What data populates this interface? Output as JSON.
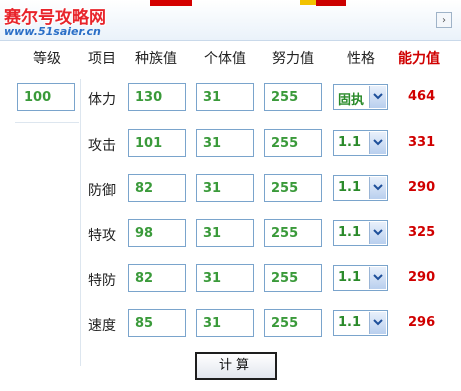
{
  "header": {
    "logo_title": "赛尔号攻略网",
    "logo_url": "www.51saier.cn",
    "nav_glyph": "›"
  },
  "columns": {
    "level": "等级",
    "item": "项目",
    "race": "种族值",
    "individual": "个体值",
    "effort": "努力值",
    "nature": "性格",
    "power": "能力值"
  },
  "level_value": "100",
  "stats": [
    {
      "label": "体力",
      "race": "130",
      "individual": "31",
      "effort": "255",
      "nature": "固执",
      "power": "464"
    },
    {
      "label": "攻击",
      "race": "101",
      "individual": "31",
      "effort": "255",
      "nature": "1.1",
      "power": "331"
    },
    {
      "label": "防御",
      "race": "82",
      "individual": "31",
      "effort": "255",
      "nature": "1.1",
      "power": "290"
    },
    {
      "label": "特攻",
      "race": "98",
      "individual": "31",
      "effort": "255",
      "nature": "1.1",
      "power": "325"
    },
    {
      "label": "特防",
      "race": "82",
      "individual": "31",
      "effort": "255",
      "nature": "1.1",
      "power": "290"
    },
    {
      "label": "速度",
      "race": "85",
      "individual": "31",
      "effort": "255",
      "nature": "1.1",
      "power": "296"
    }
  ],
  "calc_label": "计算",
  "colors": {
    "power_text": "#d00000",
    "value_text": "#3a9a3a",
    "logo_red": "#e8242b",
    "logo_blue": "#2b6fc7"
  }
}
